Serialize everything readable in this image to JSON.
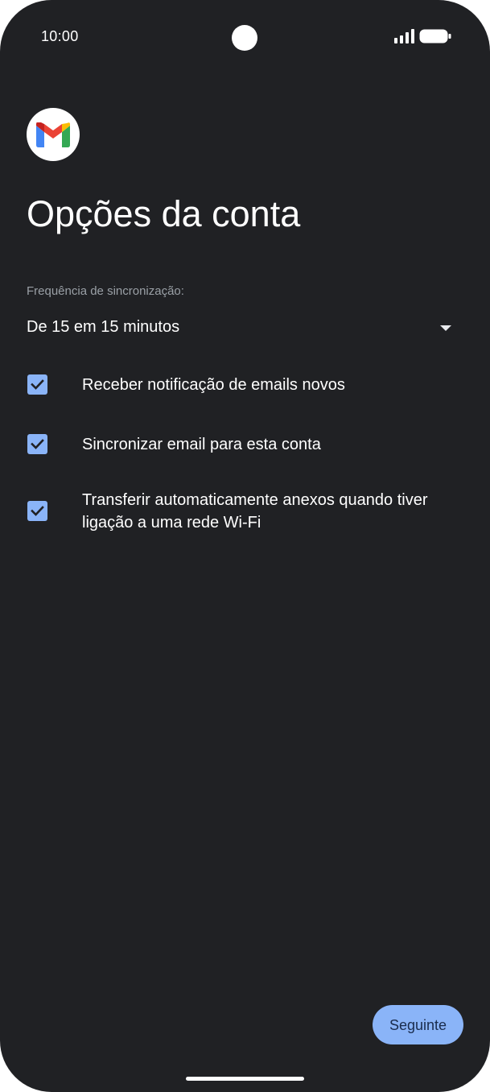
{
  "status_bar": {
    "time": "10:00",
    "icons": [
      "camera-cutout",
      "signal-icon",
      "battery-icon"
    ]
  },
  "app": {
    "logo": "gmail-logo",
    "title": "Opções da conta"
  },
  "sync": {
    "label": "Frequência de sincronização:",
    "selected": "De 15 em 15 minutos"
  },
  "options": [
    {
      "label": "Receber notificação de emails novos",
      "checked": true
    },
    {
      "label": "Sincronizar email para esta conta",
      "checked": true
    },
    {
      "label": "Transferir automaticamente anexos quando tiver ligação a uma rede Wi-Fi",
      "checked": true
    }
  ],
  "actions": {
    "next_label": "Seguinte"
  },
  "colors": {
    "background": "#202124",
    "accent": "#8ab4f8",
    "text": "#ffffff",
    "muted_text": "#9aa0a6"
  }
}
